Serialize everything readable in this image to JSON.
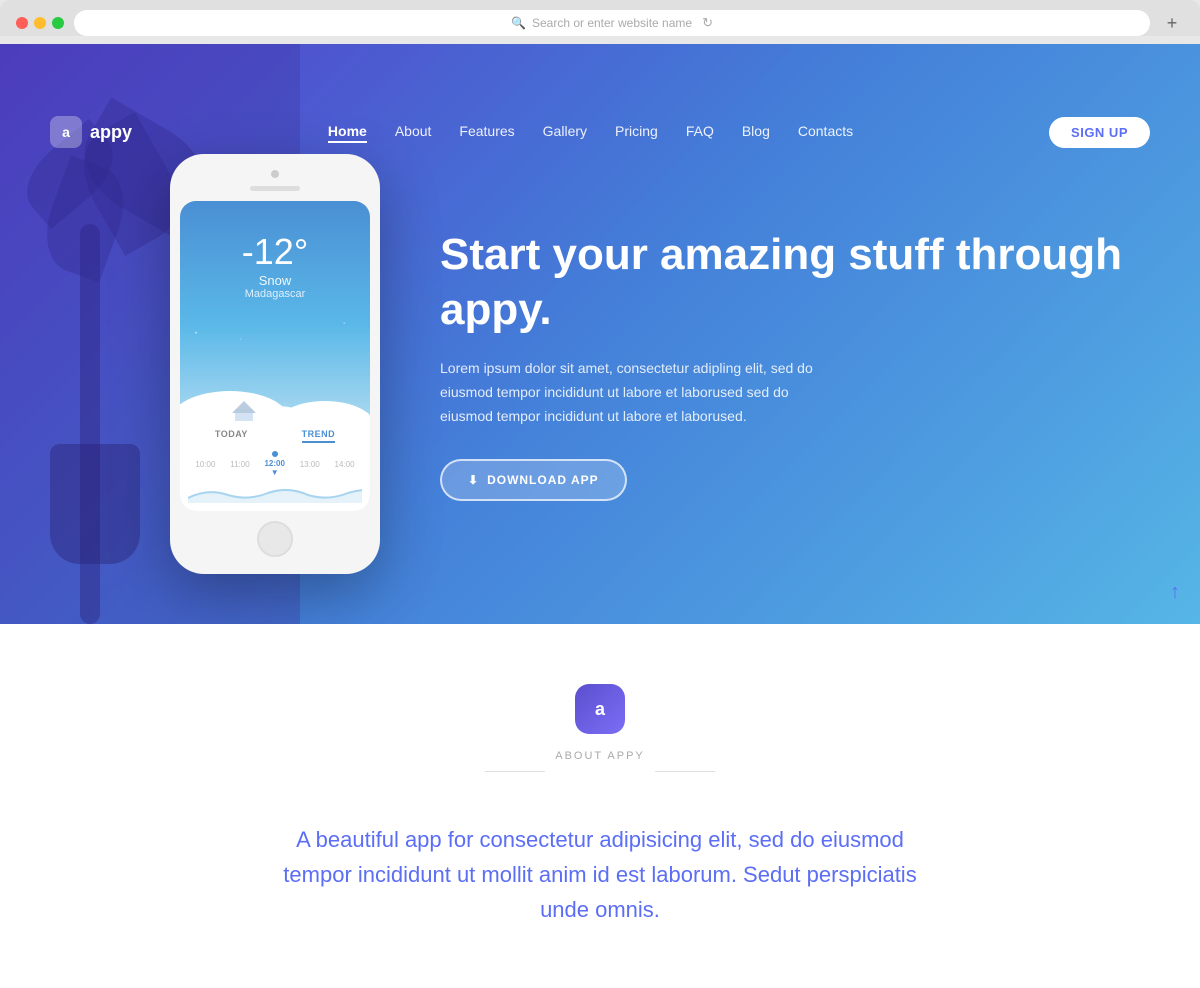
{
  "browser": {
    "address_placeholder": "Search or enter website name"
  },
  "navbar": {
    "logo_letter": "a",
    "logo_name": "appy",
    "nav_items": [
      {
        "label": "Home",
        "active": true
      },
      {
        "label": "About",
        "active": false
      },
      {
        "label": "Features",
        "active": false
      },
      {
        "label": "Gallery",
        "active": false
      },
      {
        "label": "Pricing",
        "active": false
      },
      {
        "label": "FAQ",
        "active": false
      },
      {
        "label": "Blog",
        "active": false
      },
      {
        "label": "Contacts",
        "active": false
      }
    ],
    "signup_label": "SIGN UP"
  },
  "hero": {
    "headline": "Start your amazing stuff through appy.",
    "subtext": "Lorem ipsum dolor sit amet, consectetur adipling elit, sed do eiusmod tempor incididunt ut labore et laborused sed do eiusmod tempor incididunt ut labore et laborused.",
    "download_label": "DOWNLOAD APP"
  },
  "phone": {
    "temperature": "-12°",
    "weather": "Snow",
    "location": "Madagascar",
    "tab_today": "TODAY",
    "tab_trend": "TREND",
    "times": [
      "10:00",
      "11:00",
      "12:00",
      "13:00",
      "14:00"
    ]
  },
  "about": {
    "logo_letter": "a",
    "section_label": "ABOUT APPY",
    "heading": "A beautiful app for consectetur adipisicing elit, sed do eiusmod tempor incididunt ut mollit anim id est laborum. Sedut perspiciatis unde omnis."
  }
}
